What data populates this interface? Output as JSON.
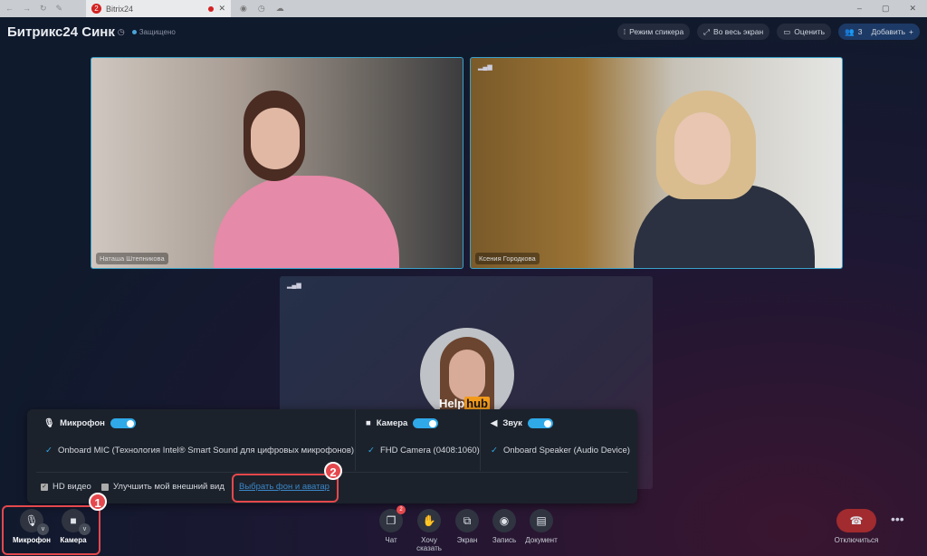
{
  "browser": {
    "tab_title": "Bitrix24",
    "tab_badge": "2"
  },
  "header": {
    "title": "Битрикс24 Синк",
    "secure": "Защищено",
    "buttons": [
      {
        "label": "Режим спикера",
        "icon": "speaker-mode-icon"
      },
      {
        "label": "Во весь экран",
        "icon": "fullscreen-icon"
      },
      {
        "label": "Оценить",
        "icon": "rate-icon"
      }
    ],
    "participants_count": "3",
    "add_label": "Добавить"
  },
  "tiles": [
    {
      "name": "Наташа Штепникова"
    },
    {
      "name": "Ксения Городкова"
    }
  ],
  "watermark": {
    "text1": "Help",
    "text2": "hub"
  },
  "settings": {
    "mic": {
      "label": "Микрофон",
      "enabled": true,
      "device": "Onboard MIC (Технология Intel® Smart Sound для цифровых микрофонов)"
    },
    "camera": {
      "label": "Камера",
      "enabled": true,
      "device": "FHD Camera (0408:1060)"
    },
    "sound": {
      "label": "Звук",
      "enabled": true,
      "device": "Onboard Speaker (Audio Device)"
    },
    "hd_video": {
      "label": "HD видео",
      "checked": true
    },
    "improve": {
      "label": "Улучшить мой внешний вид",
      "checked": false
    },
    "background_link": "Выбрать фон и аватар"
  },
  "annotations": [
    "1",
    "2"
  ],
  "accent": "#e5484d",
  "controls": {
    "mic": "Микрофон",
    "camera": "Камера",
    "chat": "Чат",
    "chat_badge": "2",
    "raise_hand_1": "Хочу",
    "raise_hand_2": "сказать",
    "screen": "Экран",
    "record": "Запись",
    "document": "Документ",
    "hangup": "Отключиться"
  }
}
